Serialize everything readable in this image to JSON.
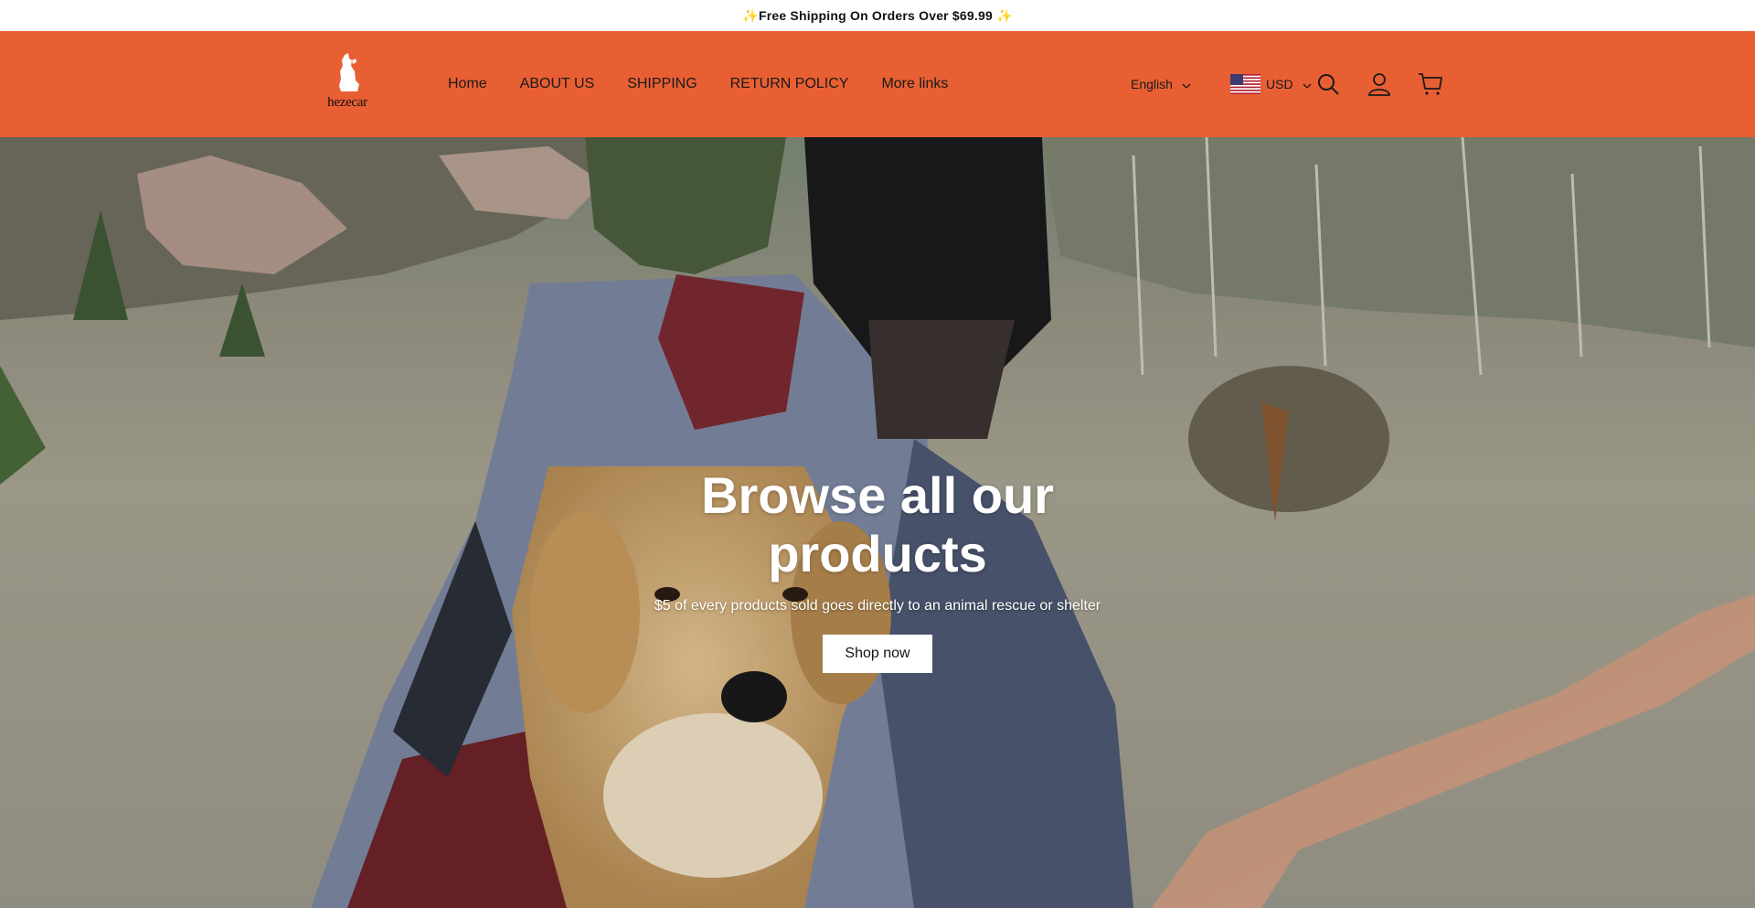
{
  "announcement": {
    "text": "✨Free Shipping On Orders Over $69.99 ✨"
  },
  "brand": {
    "logo_text": "hezecar",
    "header_color": "#e85f33"
  },
  "nav": {
    "items": [
      {
        "label": "Home"
      },
      {
        "label": "ABOUT US"
      },
      {
        "label": "SHIPPING"
      },
      {
        "label": "RETURN POLICY"
      },
      {
        "label": "More links"
      }
    ]
  },
  "localization": {
    "language": "English",
    "currency": "USD",
    "flag_icon": "us-flag-icon"
  },
  "header_icons": [
    "search-icon",
    "account-icon",
    "cart-icon"
  ],
  "hero": {
    "title": "Browse all our products",
    "subtitle": "$5 of every products sold goes directly to an animal rescue or shelter",
    "button_label": "Shop now"
  }
}
